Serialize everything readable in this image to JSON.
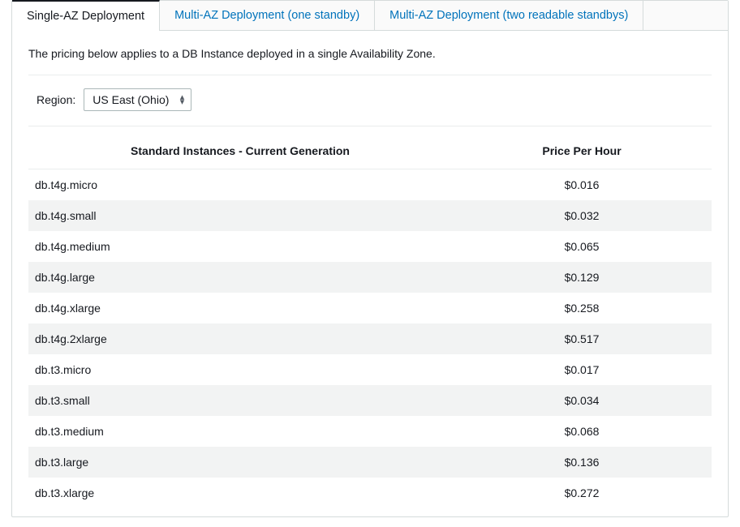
{
  "tabs": [
    {
      "label": "Single-AZ Deployment",
      "active": true
    },
    {
      "label": "Multi-AZ Deployment (one standby)",
      "active": false
    },
    {
      "label": "Multi-AZ Deployment (two readable standbys)",
      "active": false
    }
  ],
  "intro_text": "The pricing below applies to a DB Instance deployed in a single Availability Zone.",
  "region": {
    "label": "Region:",
    "selected": "US East (Ohio)"
  },
  "table": {
    "columns": {
      "instance": "Standard Instances - Current Generation",
      "price": "Price Per Hour"
    },
    "rows": [
      {
        "instance": "db.t4g.micro",
        "price": "$0.016"
      },
      {
        "instance": "db.t4g.small",
        "price": "$0.032"
      },
      {
        "instance": "db.t4g.medium",
        "price": "$0.065"
      },
      {
        "instance": "db.t4g.large",
        "price": "$0.129"
      },
      {
        "instance": "db.t4g.xlarge",
        "price": "$0.258"
      },
      {
        "instance": "db.t4g.2xlarge",
        "price": "$0.517"
      },
      {
        "instance": "db.t3.micro",
        "price": "$0.017"
      },
      {
        "instance": "db.t3.small",
        "price": "$0.034"
      },
      {
        "instance": "db.t3.medium",
        "price": "$0.068"
      },
      {
        "instance": "db.t3.large",
        "price": "$0.136"
      },
      {
        "instance": "db.t3.xlarge",
        "price": "$0.272"
      }
    ]
  }
}
